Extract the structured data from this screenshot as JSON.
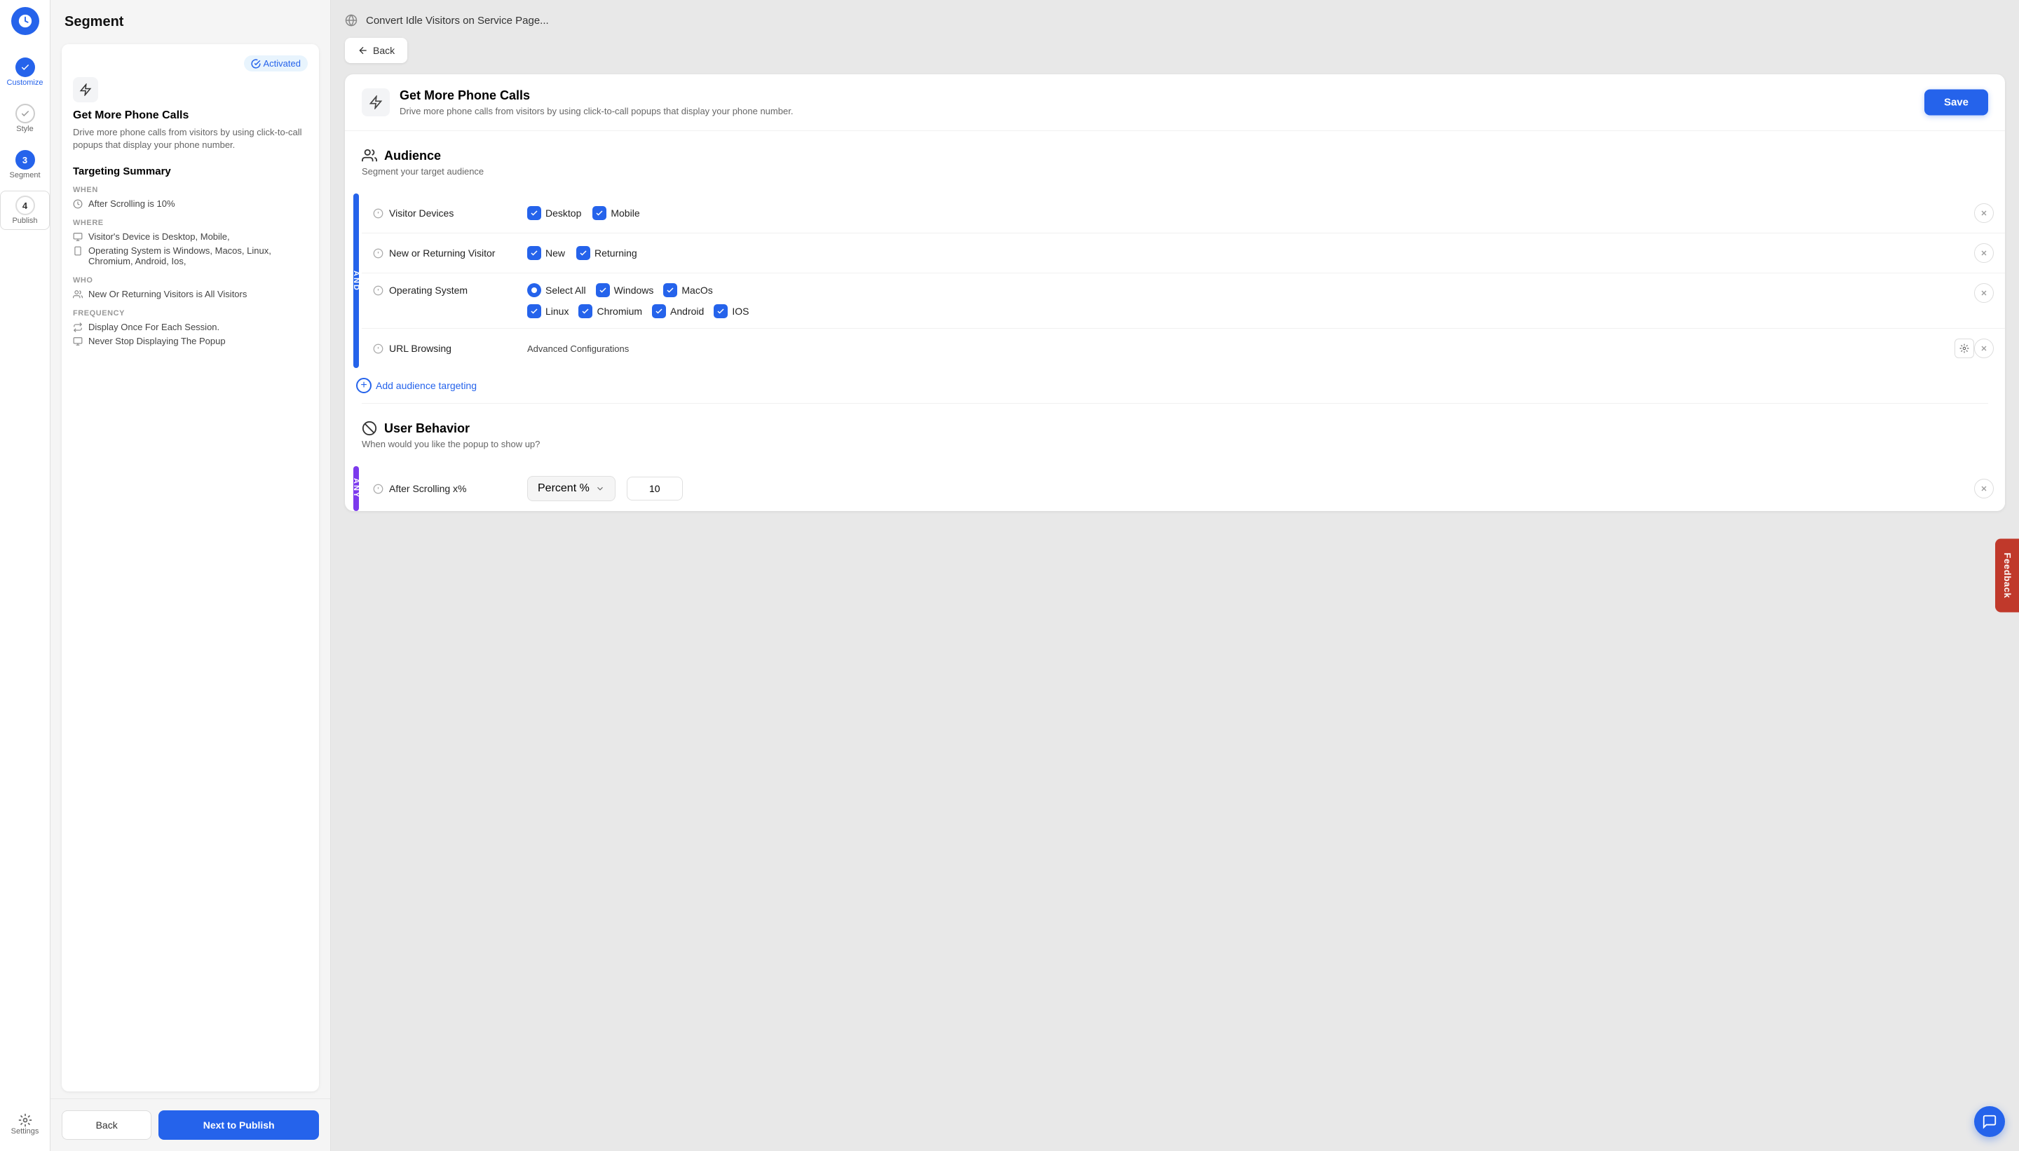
{
  "app": {
    "logo_alt": "App logo",
    "title": "Convert Idle Visitors on Service Page..."
  },
  "sidebar": {
    "items": [
      {
        "id": "customize",
        "label": "Customize",
        "type": "check"
      },
      {
        "id": "style",
        "label": "Style",
        "type": "check"
      },
      {
        "id": "segment",
        "label": "Segment",
        "type": "number",
        "number": "3",
        "active": true
      },
      {
        "id": "publish",
        "label": "Publish",
        "type": "number",
        "number": "4"
      },
      {
        "id": "settings",
        "label": "Settings",
        "type": "gear"
      }
    ]
  },
  "segment_panel": {
    "header": "Segment",
    "campaign": {
      "title": "Get More Phone Calls",
      "description": "Drive more phone calls from visitors by using click-to-call popups that display your phone number.",
      "activated_label": "Activated"
    },
    "targeting_summary": {
      "title": "Targeting Summary",
      "when_label": "WHEN",
      "when_items": [
        "After Scrolling is 10%"
      ],
      "where_label": "WHERE",
      "where_items": [
        "Visitor's Device is Desktop, Mobile,",
        "Operating System is Windows, Macos, Linux, Chromium, Android, Ios,"
      ],
      "who_label": "WHO",
      "who_items": [
        "New Or Returning Visitors is All Visitors"
      ],
      "frequency_label": "FREQUENCY",
      "frequency_items": [
        "Display Once For Each Session.",
        "Never Stop Displaying The Popup"
      ]
    },
    "back_label": "Back",
    "next_label": "Next to Publish"
  },
  "main": {
    "back_label": "Back",
    "campaign": {
      "title": "Get More Phone Calls",
      "description": "Drive more phone calls from visitors by using click-to-call popups that display your phone number.",
      "save_label": "Save"
    },
    "audience": {
      "title": "Audience",
      "subtitle": "Segment your target audience",
      "rows": [
        {
          "id": "visitor-devices",
          "label": "Visitor Devices",
          "options": [
            {
              "label": "Desktop",
              "checked": true,
              "type": "checkbox"
            },
            {
              "label": "Mobile",
              "checked": true,
              "type": "checkbox"
            }
          ]
        },
        {
          "id": "new-returning",
          "label": "New or Returning Visitor",
          "options": [
            {
              "label": "New",
              "checked": true,
              "type": "checkbox"
            },
            {
              "label": "Returning",
              "checked": true,
              "type": "checkbox"
            }
          ]
        },
        {
          "id": "operating-system",
          "label": "Operating System",
          "options": [
            {
              "label": "Select All",
              "checked": true,
              "type": "radio"
            },
            {
              "label": "Windows",
              "checked": true,
              "type": "checkbox"
            },
            {
              "label": "MacOs",
              "checked": true,
              "type": "checkbox"
            },
            {
              "label": "Linux",
              "checked": true,
              "type": "checkbox"
            },
            {
              "label": "Chromium",
              "checked": true,
              "type": "checkbox"
            },
            {
              "label": "Android",
              "checked": true,
              "type": "checkbox"
            },
            {
              "label": "IOS",
              "checked": true,
              "type": "checkbox"
            }
          ]
        },
        {
          "id": "url-browsing",
          "label": "URL Browsing",
          "advanced": "Advanced Configurations"
        }
      ],
      "add_targeting_label": "Add audience targeting",
      "connector": "AND"
    },
    "user_behavior": {
      "title": "User Behavior",
      "subtitle": "When would you like the popup to show up?",
      "rows": [
        {
          "id": "after-scrolling",
          "label": "After Scrolling x%",
          "dropdown_label": "Percent %",
          "value": "10"
        }
      ],
      "connector": "ANY"
    },
    "feedback_label": "Feedback",
    "chat_icon": "chat-icon"
  }
}
